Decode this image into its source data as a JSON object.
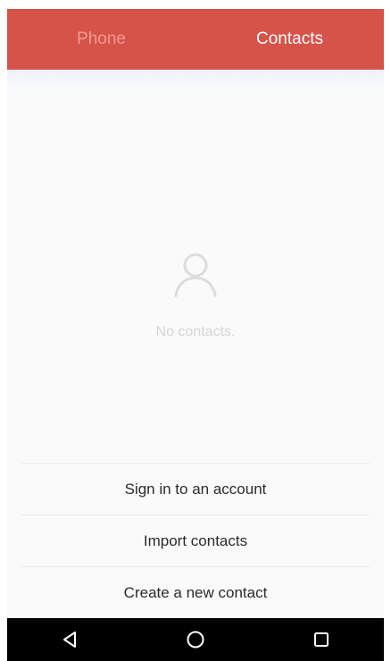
{
  "tabs": [
    {
      "label": "Phone",
      "active": false
    },
    {
      "label": "Contacts",
      "active": true
    }
  ],
  "empty_state": {
    "icon": "person-icon",
    "message": "No contacts."
  },
  "actions": [
    {
      "label": "Sign in to an account"
    },
    {
      "label": "Import contacts"
    },
    {
      "label": "Create a new contact"
    }
  ],
  "nav": {
    "back_icon": "back-triangle-icon",
    "home_icon": "home-circle-icon",
    "recents_icon": "recents-square-icon"
  },
  "colors": {
    "tab_bar": "#d6534a",
    "tab_active_text": "#ffffff",
    "tab_inactive_text": "#f29a93",
    "background": "#fafafa",
    "nav_bar": "#000000"
  }
}
